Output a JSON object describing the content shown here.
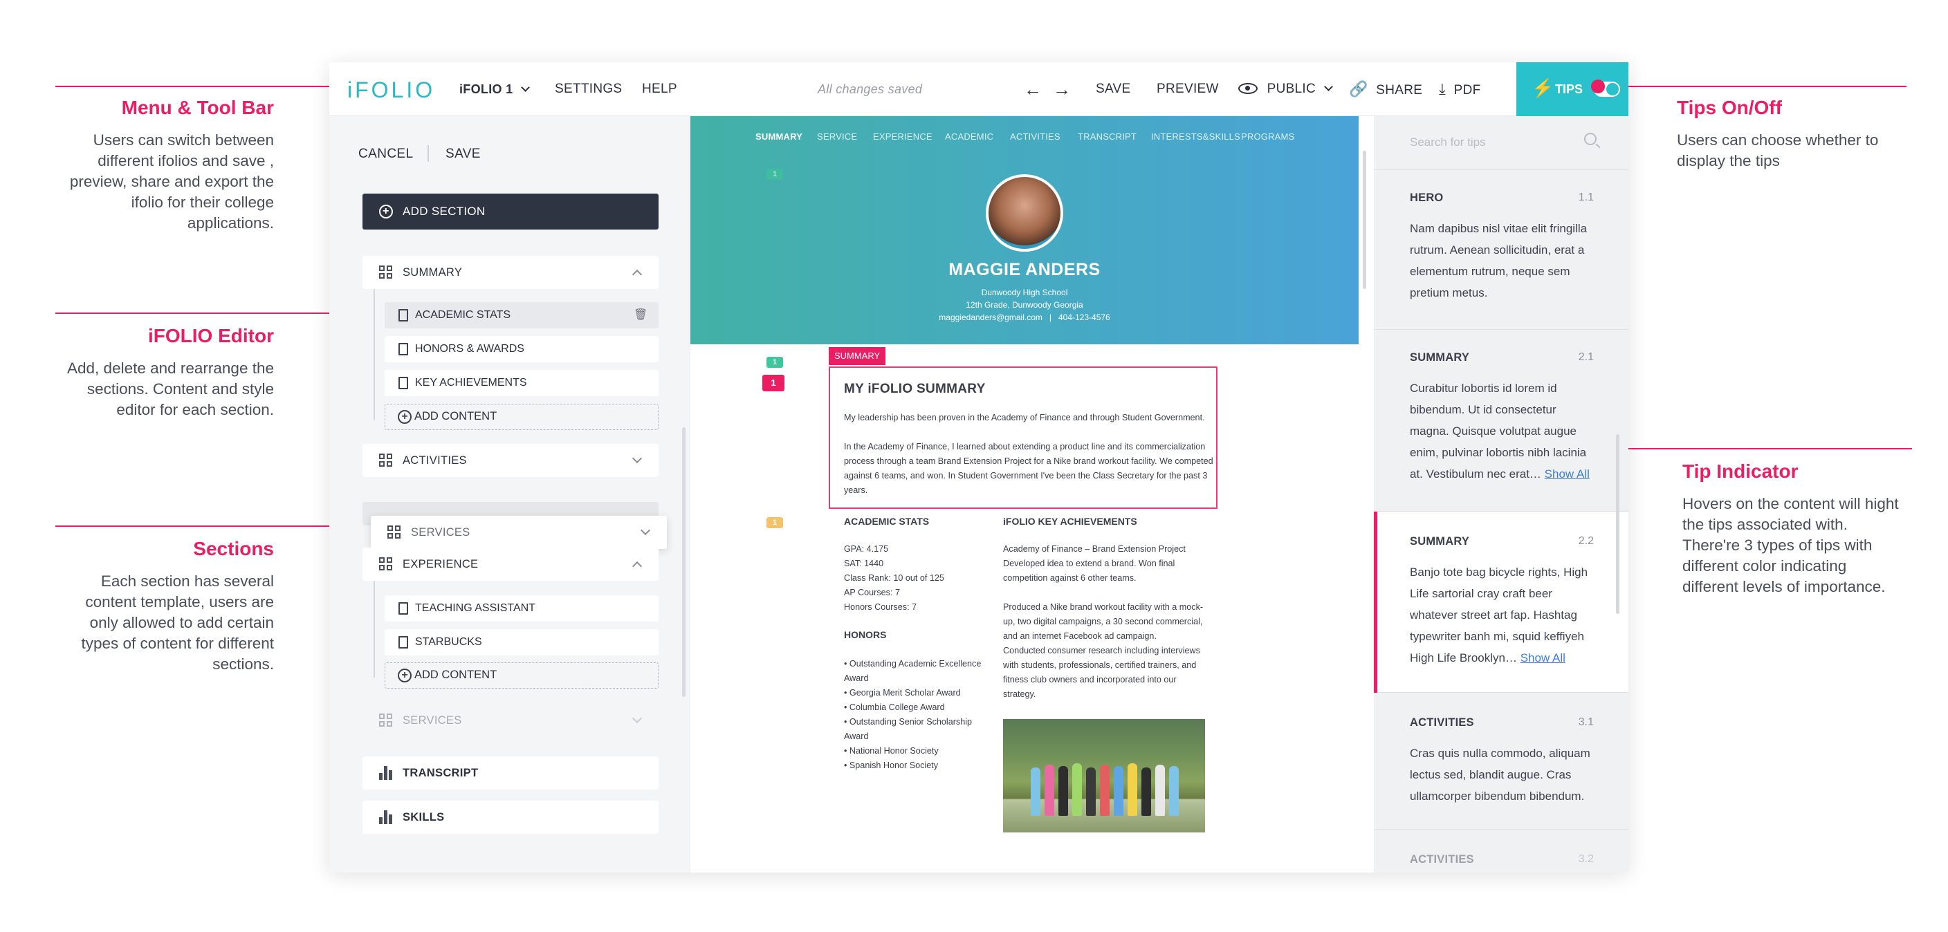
{
  "annotations": {
    "menu_toolbar": {
      "title": "Menu & Tool Bar",
      "lines": [
        "Users can switch between",
        "different ifolios and save ,",
        "preview, share and export the",
        "ifolio for their college",
        "applications."
      ]
    },
    "ifolio_editor": {
      "title": "iFOLIO Editor",
      "lines": [
        "Add, delete and rearrange the",
        "sections. Content and style",
        "editor for each section."
      ]
    },
    "sections": {
      "title": "Sections",
      "lines": [
        "Each section has several",
        "content template, users are",
        "only allowed to add certain",
        "types of content for different",
        "sections."
      ]
    },
    "tips_onoff": {
      "title": "Tips On/Off",
      "lines": [
        "Users can choose whether to",
        "display the tips"
      ]
    },
    "tip_indicator": {
      "title": "Tip Indicator",
      "lines": [
        "Hovers on the content will hight",
        "the tips associated with.",
        "There're 3 types of tips with",
        "different color indicating",
        "different levels of importance."
      ]
    }
  },
  "topbar": {
    "logo": "iFOLIO",
    "ifolio_select": "iFOLIO 1",
    "settings": "SETTINGS",
    "help": "HELP",
    "status": "All changes saved",
    "save": "SAVE",
    "preview": "PREVIEW",
    "public": "PUBLIC",
    "share": "SHARE",
    "pdf": "PDF",
    "tips": "TIPS"
  },
  "editor": {
    "cancel": "CANCEL",
    "save": "SAVE",
    "add_section": "ADD SECTION",
    "summary": "SUMMARY",
    "summary_items": [
      "ACADEMIC STATS",
      "HONORS & AWARDS",
      "KEY ACHIEVEMENTS"
    ],
    "add_content": "ADD CONTENT",
    "activities": "ACTIVITIES",
    "services_dragging": "SERVICES",
    "experience": "EXPERIENCE",
    "experience_items": [
      "TEACHING ASSISTANT",
      "STARBUCKS"
    ],
    "add_content_2": "ADD CONTENT",
    "services_ghost": "SERVICES",
    "transcript": "TRANSCRIPT",
    "skills": "SKILLS"
  },
  "preview": {
    "nav": [
      "SUMMARY",
      "SERVICE",
      "EXPERIENCE",
      "ACADEMIC",
      "ACTIVITIES",
      "TRANSCRIPT",
      "INTERESTS&SKILLS",
      "PROGRAMS"
    ],
    "name": "MAGGIE ANDERS",
    "school": "Dunwoody High School",
    "grade": "12th Grade, Dunwoody Georgia",
    "contact": "maggiedanders@gmail.com   |   404-123-4576",
    "summary_tag": "SUMMARY",
    "summary_title": "MY iFOLIO SUMMARY",
    "summary_p1": "My leadership has been proven in the Academy of Finance and through Student Government.",
    "summary_p2_lines": [
      "In the Academy of Finance, I learned about extending a product line and its commercialization",
      "process through a team Brand Extension Project for a Nike brand workout facility. We competed",
      "against 6 teams, and won. In Student Government I've been the Class Secretary for the past 3",
      "years."
    ],
    "academic_title": "ACADEMIC STATS",
    "academic_lines": [
      "GPA: 4.175",
      "SAT: 1440",
      "Class Rank: 10 out of 125",
      "AP Courses: 7",
      "Honors Courses: 7"
    ],
    "honors_title": "HONORS",
    "honors_lines": [
      "• Outstanding Academic Excellence",
      "Award",
      "• Georgia Merit Scholar Award",
      "• Columbia College Award",
      "• Outstanding Senior Scholarship",
      "Award",
      "• National Honor Society",
      "• Spanish Honor Society"
    ],
    "achievements_title": "iFOLIO KEY ACHIEVEMENTS",
    "achievements_lines": [
      "Academy of Finance – Brand Extension Project",
      "Developed idea to extend a brand.  Won final",
      "competition against 6 other teams.",
      "",
      "Produced a Nike brand workout facility with a mock-",
      "up, two digital campaigns, a 30 second commercial,",
      "and an internet Facebook ad campaign.",
      "Conducted consumer research including interviews",
      "with students, professionals, certified trainers, and",
      "fitness club owners and incorporated into our",
      "strategy."
    ],
    "tip_markers": [
      "1",
      "1",
      "1",
      "1"
    ]
  },
  "tips_panel": {
    "search_placeholder": "Search for tips",
    "tips": [
      {
        "title": "HERO",
        "num": "1.1",
        "lines": [
          "Nam dapibus nisl vitae elit fringilla",
          "rutrum. Aenean sollicitudin, erat a",
          "elementum rutrum, neque sem",
          "pretium metus."
        ],
        "show_all": ""
      },
      {
        "title": "SUMMARY",
        "num": "2.1",
        "lines": [
          "Curabitur lobortis id lorem id",
          "bibendum. Ut id consectetur",
          "magna. Quisque volutpat augue",
          "enim, pulvinar lobortis nibh lacinia",
          "at. Vestibulum nec erat…"
        ],
        "show_all": "Show All"
      },
      {
        "title": "SUMMARY",
        "num": "2.2",
        "lines": [
          "Banjo tote bag bicycle rights, High",
          "Life sartorial cray craft beer",
          "whatever street art fap. Hashtag",
          "typewriter banh mi, squid keffiyeh",
          "High Life Brooklyn…"
        ],
        "show_all": "Show All"
      },
      {
        "title": "ACTIVITIES",
        "num": "3.1",
        "lines": [
          "Cras quis nulla commodo, aliquam",
          "lectus sed, blandit augue. Cras",
          "ullamcorper bibendum bibendum."
        ],
        "show_all": ""
      },
      {
        "title": "ACTIVITIES",
        "num": "3.2",
        "lines": [],
        "show_all": ""
      }
    ]
  },
  "colors": {
    "accent": "#ea1f63",
    "teal": "#29c2cc",
    "dark": "#2f3442",
    "tip_green": "#3ec79a",
    "tip_red": "#ea1f63",
    "tip_yellow": "#f3c26b"
  }
}
